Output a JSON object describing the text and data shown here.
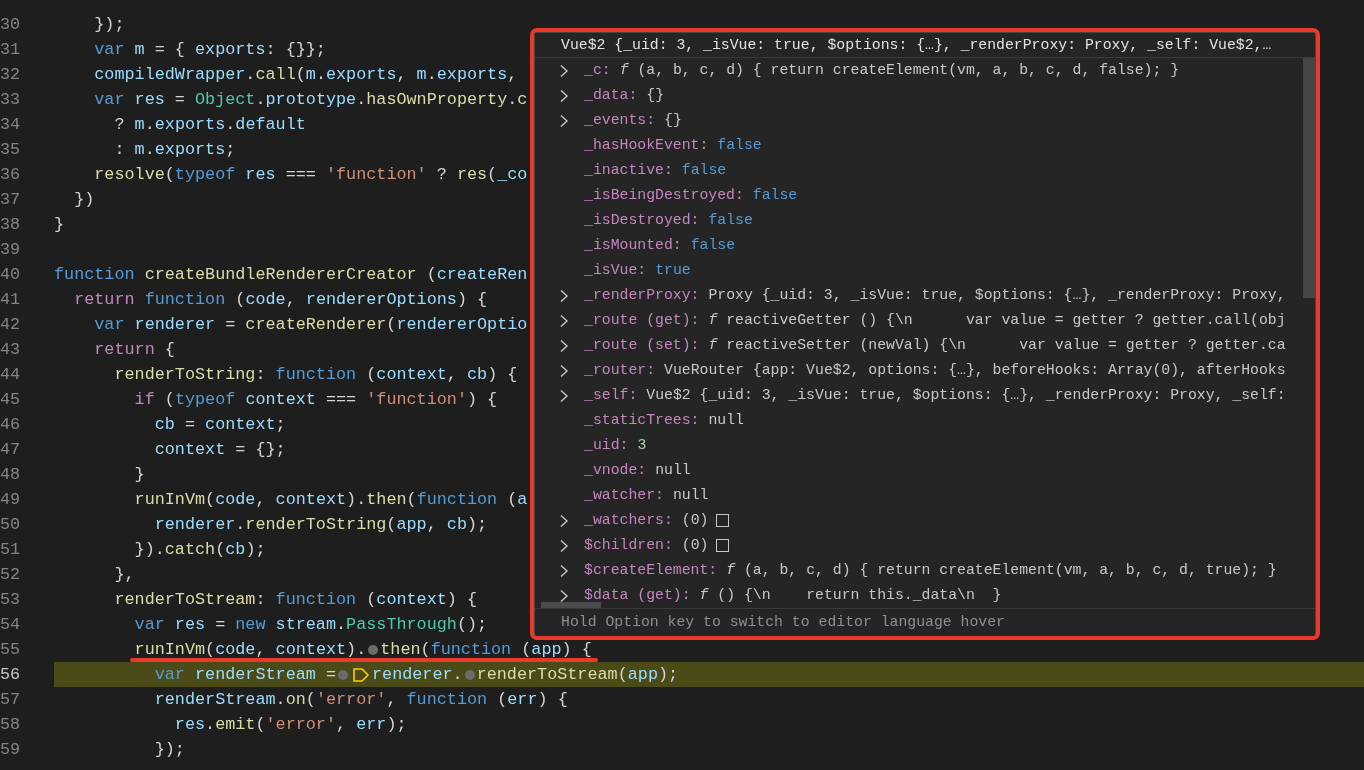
{
  "editor": {
    "lines": [
      {
        "number": "30",
        "current": false,
        "tokens": [
          {
            "kind": "plain",
            "text": "    });"
          }
        ]
      },
      {
        "number": "31",
        "current": false,
        "tokens": [
          {
            "kind": "keyword",
            "text": "    var"
          },
          {
            "kind": "variable",
            "text": " m"
          },
          {
            "kind": "plain",
            "text": " = { "
          },
          {
            "kind": "variable",
            "text": "exports"
          },
          {
            "kind": "plain",
            "text": ": {}};"
          }
        ]
      },
      {
        "number": "32",
        "current": false,
        "tokens": [
          {
            "kind": "variable",
            "text": "    compiledWrapper"
          },
          {
            "kind": "plain",
            "text": "."
          },
          {
            "kind": "function",
            "text": "call"
          },
          {
            "kind": "plain",
            "text": "("
          },
          {
            "kind": "variable",
            "text": "m"
          },
          {
            "kind": "plain",
            "text": "."
          },
          {
            "kind": "variable",
            "text": "exports"
          },
          {
            "kind": "plain",
            "text": ", "
          },
          {
            "kind": "variable",
            "text": "m"
          },
          {
            "kind": "plain",
            "text": "."
          },
          {
            "kind": "variable",
            "text": "exports"
          },
          {
            "kind": "plain",
            "text": ","
          }
        ]
      },
      {
        "number": "33",
        "current": false,
        "tokens": [
          {
            "kind": "keyword",
            "text": "    var"
          },
          {
            "kind": "variable",
            "text": " res"
          },
          {
            "kind": "plain",
            "text": " = "
          },
          {
            "kind": "type",
            "text": "Object"
          },
          {
            "kind": "plain",
            "text": "."
          },
          {
            "kind": "variable",
            "text": "prototype"
          },
          {
            "kind": "plain",
            "text": "."
          },
          {
            "kind": "function",
            "text": "hasOwnProperty"
          },
          {
            "kind": "plain",
            "text": "."
          },
          {
            "kind": "function",
            "text": "c"
          }
        ]
      },
      {
        "number": "34",
        "current": false,
        "tokens": [
          {
            "kind": "plain",
            "text": "      ? "
          },
          {
            "kind": "variable",
            "text": "m"
          },
          {
            "kind": "plain",
            "text": "."
          },
          {
            "kind": "variable",
            "text": "exports"
          },
          {
            "kind": "plain",
            "text": "."
          },
          {
            "kind": "variable",
            "text": "default"
          }
        ]
      },
      {
        "number": "35",
        "current": false,
        "tokens": [
          {
            "kind": "plain",
            "text": "      : "
          },
          {
            "kind": "variable",
            "text": "m"
          },
          {
            "kind": "plain",
            "text": "."
          },
          {
            "kind": "variable",
            "text": "exports"
          },
          {
            "kind": "plain",
            "text": ";"
          }
        ]
      },
      {
        "number": "36",
        "current": false,
        "tokens": [
          {
            "kind": "function",
            "text": "    resolve"
          },
          {
            "kind": "plain",
            "text": "("
          },
          {
            "kind": "keyword",
            "text": "typeof"
          },
          {
            "kind": "variable",
            "text": " res"
          },
          {
            "kind": "plain",
            "text": " === "
          },
          {
            "kind": "string",
            "text": "'function'"
          },
          {
            "kind": "plain",
            "text": " ? "
          },
          {
            "kind": "function",
            "text": "res"
          },
          {
            "kind": "plain",
            "text": "("
          },
          {
            "kind": "variable",
            "text": "_co"
          }
        ]
      },
      {
        "number": "37",
        "current": false,
        "tokens": [
          {
            "kind": "plain",
            "text": "  })"
          }
        ]
      },
      {
        "number": "38",
        "current": false,
        "tokens": [
          {
            "kind": "plain",
            "text": "}"
          }
        ]
      },
      {
        "number": "39",
        "current": false
      },
      {
        "number": "40",
        "current": false,
        "tokens": [
          {
            "kind": "keyword",
            "text": "function"
          },
          {
            "kind": "function",
            "text": " createBundleRendererCreator"
          },
          {
            "kind": "plain",
            "text": " ("
          },
          {
            "kind": "variable",
            "text": "createRen"
          }
        ]
      },
      {
        "number": "41",
        "current": false,
        "tokens": [
          {
            "kind": "control",
            "text": "  return"
          },
          {
            "kind": "keyword",
            "text": " function"
          },
          {
            "kind": "plain",
            "text": " ("
          },
          {
            "kind": "variable",
            "text": "code"
          },
          {
            "kind": "plain",
            "text": ", "
          },
          {
            "kind": "variable",
            "text": "rendererOptions"
          },
          {
            "kind": "plain",
            "text": ") {"
          }
        ]
      },
      {
        "number": "42",
        "current": false,
        "tokens": [
          {
            "kind": "keyword",
            "text": "    var"
          },
          {
            "kind": "variable",
            "text": " renderer"
          },
          {
            "kind": "plain",
            "text": " = "
          },
          {
            "kind": "function",
            "text": "createRenderer"
          },
          {
            "kind": "plain",
            "text": "("
          },
          {
            "kind": "variable",
            "text": "rendererOptio"
          }
        ]
      },
      {
        "number": "43",
        "current": false,
        "tokens": [
          {
            "kind": "control",
            "text": "    return"
          },
          {
            "kind": "plain",
            "text": " {"
          }
        ]
      },
      {
        "number": "44",
        "current": false,
        "tokens": [
          {
            "kind": "function",
            "text": "      renderToString"
          },
          {
            "kind": "plain",
            "text": ": "
          },
          {
            "kind": "keyword",
            "text": "function"
          },
          {
            "kind": "plain",
            "text": " ("
          },
          {
            "kind": "variable",
            "text": "context"
          },
          {
            "kind": "plain",
            "text": ", "
          },
          {
            "kind": "variable",
            "text": "cb"
          },
          {
            "kind": "plain",
            "text": ") {"
          }
        ]
      },
      {
        "number": "45",
        "current": false,
        "tokens": [
          {
            "kind": "control",
            "text": "        if"
          },
          {
            "kind": "plain",
            "text": " ("
          },
          {
            "kind": "keyword",
            "text": "typeof"
          },
          {
            "kind": "variable",
            "text": " context"
          },
          {
            "kind": "plain",
            "text": " === "
          },
          {
            "kind": "string",
            "text": "'function'"
          },
          {
            "kind": "plain",
            "text": ") {"
          }
        ]
      },
      {
        "number": "46",
        "current": false,
        "tokens": [
          {
            "kind": "variable",
            "text": "          cb"
          },
          {
            "kind": "plain",
            "text": " = "
          },
          {
            "kind": "variable",
            "text": "context"
          },
          {
            "kind": "plain",
            "text": ";"
          }
        ]
      },
      {
        "number": "47",
        "current": false,
        "tokens": [
          {
            "kind": "variable",
            "text": "          context"
          },
          {
            "kind": "plain",
            "text": " = {};"
          }
        ]
      },
      {
        "number": "48",
        "current": false,
        "tokens": [
          {
            "kind": "plain",
            "text": "        }"
          }
        ]
      },
      {
        "number": "49",
        "current": false,
        "tokens": [
          {
            "kind": "function",
            "text": "        runInVm"
          },
          {
            "kind": "plain",
            "text": "("
          },
          {
            "kind": "variable",
            "text": "code"
          },
          {
            "kind": "plain",
            "text": ", "
          },
          {
            "kind": "variable",
            "text": "context"
          },
          {
            "kind": "plain",
            "text": ")."
          },
          {
            "kind": "function",
            "text": "then"
          },
          {
            "kind": "plain",
            "text": "("
          },
          {
            "kind": "keyword",
            "text": "function"
          },
          {
            "kind": "plain",
            "text": " ("
          },
          {
            "kind": "variable",
            "text": "a"
          }
        ]
      },
      {
        "number": "50",
        "current": false,
        "tokens": [
          {
            "kind": "variable",
            "text": "          renderer"
          },
          {
            "kind": "plain",
            "text": "."
          },
          {
            "kind": "function",
            "text": "renderToString"
          },
          {
            "kind": "plain",
            "text": "("
          },
          {
            "kind": "variable",
            "text": "app"
          },
          {
            "kind": "plain",
            "text": ", "
          },
          {
            "kind": "variable",
            "text": "cb"
          },
          {
            "kind": "plain",
            "text": ");"
          }
        ]
      },
      {
        "number": "51",
        "current": false,
        "tokens": [
          {
            "kind": "plain",
            "text": "        })."
          },
          {
            "kind": "function",
            "text": "catch"
          },
          {
            "kind": "plain",
            "text": "("
          },
          {
            "kind": "variable",
            "text": "cb"
          },
          {
            "kind": "plain",
            "text": ");"
          }
        ]
      },
      {
        "number": "52",
        "current": false,
        "tokens": [
          {
            "kind": "plain",
            "text": "      },"
          }
        ]
      },
      {
        "number": "53",
        "current": false,
        "tokens": [
          {
            "kind": "function",
            "text": "      renderToStream"
          },
          {
            "kind": "plain",
            "text": ": "
          },
          {
            "kind": "keyword",
            "text": "function"
          },
          {
            "kind": "plain",
            "text": " ("
          },
          {
            "kind": "variable",
            "text": "context"
          },
          {
            "kind": "plain",
            "text": ") {"
          }
        ]
      },
      {
        "number": "54",
        "current": false,
        "tokens": [
          {
            "kind": "keyword",
            "text": "        var"
          },
          {
            "kind": "variable",
            "text": " res"
          },
          {
            "kind": "plain",
            "text": " = "
          },
          {
            "kind": "keyword",
            "text": "new"
          },
          {
            "kind": "variable",
            "text": " stream"
          },
          {
            "kind": "plain",
            "text": "."
          },
          {
            "kind": "type",
            "text": "PassThrough"
          },
          {
            "kind": "plain",
            "text": "();"
          }
        ]
      },
      {
        "number": "55",
        "current": false,
        "tokens": [
          {
            "kind": "function",
            "text": "        runInVm"
          },
          {
            "kind": "plain",
            "text": "("
          },
          {
            "kind": "variable",
            "text": "code"
          },
          {
            "kind": "plain",
            "text": ", "
          },
          {
            "kind": "variable",
            "text": "context"
          },
          {
            "kind": "plain",
            "text": ")."
          },
          {
            "kind": "breakpoint"
          },
          {
            "kind": "function",
            "text": "then"
          },
          {
            "kind": "plain",
            "text": "("
          },
          {
            "kind": "keyword",
            "text": "function"
          },
          {
            "kind": "plain",
            "text": " ("
          },
          {
            "kind": "variable",
            "text": "app"
          },
          {
            "kind": "plain",
            "text": ") {"
          }
        ]
      },
      {
        "number": "56",
        "current": true,
        "tokens": [
          {
            "kind": "keyword",
            "text": "          var"
          },
          {
            "kind": "variable",
            "text": " renderStream"
          },
          {
            "kind": "plain",
            "text": " ="
          },
          {
            "kind": "breakpoint"
          },
          {
            "kind": "pointer"
          },
          {
            "kind": "variable",
            "text": "renderer"
          },
          {
            "kind": "plain",
            "text": "."
          },
          {
            "kind": "breakpoint"
          },
          {
            "kind": "function",
            "text": "renderToStream"
          },
          {
            "kind": "plain",
            "text": "("
          },
          {
            "kind": "variable",
            "text": "app"
          },
          {
            "kind": "plain",
            "text": ");"
          }
        ]
      },
      {
        "number": "57",
        "current": false,
        "tokens": [
          {
            "kind": "variable",
            "text": "          renderStream"
          },
          {
            "kind": "plain",
            "text": "."
          },
          {
            "kind": "function",
            "text": "on"
          },
          {
            "kind": "plain",
            "text": "("
          },
          {
            "kind": "string",
            "text": "'error'"
          },
          {
            "kind": "plain",
            "text": ", "
          },
          {
            "kind": "keyword",
            "text": "function"
          },
          {
            "kind": "plain",
            "text": " ("
          },
          {
            "kind": "variable",
            "text": "err"
          },
          {
            "kind": "plain",
            "text": ") {"
          }
        ]
      },
      {
        "number": "58",
        "current": false,
        "tokens": [
          {
            "kind": "variable",
            "text": "            res"
          },
          {
            "kind": "plain",
            "text": "."
          },
          {
            "kind": "function",
            "text": "emit"
          },
          {
            "kind": "plain",
            "text": "("
          },
          {
            "kind": "string",
            "text": "'error'"
          },
          {
            "kind": "plain",
            "text": ", "
          },
          {
            "kind": "variable",
            "text": "err"
          },
          {
            "kind": "plain",
            "text": ");"
          }
        ]
      },
      {
        "number": "59",
        "current": false,
        "tokens": [
          {
            "kind": "plain",
            "text": "          });"
          }
        ]
      }
    ]
  },
  "hover": {
    "summary": "Vue$2 {_uid: 3, _isVue: true, $options: {…}, _renderProxy: Proxy, _self: Vue$2,…",
    "rows": [
      {
        "expandable": true,
        "label": "_c:",
        "kind": "function",
        "value": "*f* (a, b, c, d) { return createElement(vm, a, b, c, d, false); }"
      },
      {
        "expandable": true,
        "label": "_data:",
        "kind": "object",
        "value": "{}"
      },
      {
        "expandable": true,
        "label": "_events:",
        "kind": "object",
        "value": "{}"
      },
      {
        "expandable": false,
        "label": "_hasHookEvent:",
        "kind": "boolean",
        "value": "false"
      },
      {
        "expandable": false,
        "label": "_inactive:",
        "kind": "boolean",
        "value": "false"
      },
      {
        "expandable": false,
        "label": "_isBeingDestroyed:",
        "kind": "boolean",
        "value": "false"
      },
      {
        "expandable": false,
        "label": "_isDestroyed:",
        "kind": "boolean",
        "value": "false"
      },
      {
        "expandable": false,
        "label": "_isMounted:",
        "kind": "boolean",
        "value": "false"
      },
      {
        "expandable": false,
        "label": "_isVue:",
        "kind": "boolean",
        "value": "true"
      },
      {
        "expandable": true,
        "label": "_renderProxy:",
        "kind": "object",
        "value": "Proxy {_uid: 3, _isVue: true, $options: {…}, _renderProxy: Proxy,"
      },
      {
        "expandable": true,
        "label": "_route (get):",
        "kind": "function",
        "value": "*f* reactiveGetter () {\\n      var value = getter ? getter.call(obj"
      },
      {
        "expandable": true,
        "label": "_route (set):",
        "kind": "function",
        "value": "*f* reactiveSetter (newVal) {\\n      var value = getter ? getter.ca"
      },
      {
        "expandable": true,
        "label": "_router:",
        "kind": "object",
        "value": "VueRouter {app: Vue$2, options: {…}, beforeHooks: Array(0), afterHooks"
      },
      {
        "expandable": true,
        "label": "_self:",
        "kind": "object",
        "value": "Vue$2 {_uid: 3, _isVue: true, $options: {…}, _renderProxy: Proxy, _self:"
      },
      {
        "expandable": false,
        "label": "_staticTrees:",
        "kind": "null",
        "value": "null"
      },
      {
        "expandable": false,
        "label": "_uid:",
        "kind": "number",
        "value": "3"
      },
      {
        "expandable": false,
        "label": "_vnode:",
        "kind": "null",
        "value": "null"
      },
      {
        "expandable": false,
        "label": "_watcher:",
        "kind": "null",
        "value": "null"
      },
      {
        "expandable": true,
        "label": "_watchers:",
        "kind": "array",
        "value": "(0)"
      },
      {
        "expandable": true,
        "label": "$children:",
        "kind": "array",
        "value": "(0)"
      },
      {
        "expandable": true,
        "label": "$createElement:",
        "kind": "function",
        "value": "*f* (a, b, c, d) { return createElement(vm, a, b, c, d, true); }"
      },
      {
        "expandable": true,
        "label": "$data (get):",
        "kind": "function",
        "value": "*f* () {\\n    return this._data\\n  }"
      }
    ],
    "footer": "Hold Option key to switch to editor language hover"
  }
}
